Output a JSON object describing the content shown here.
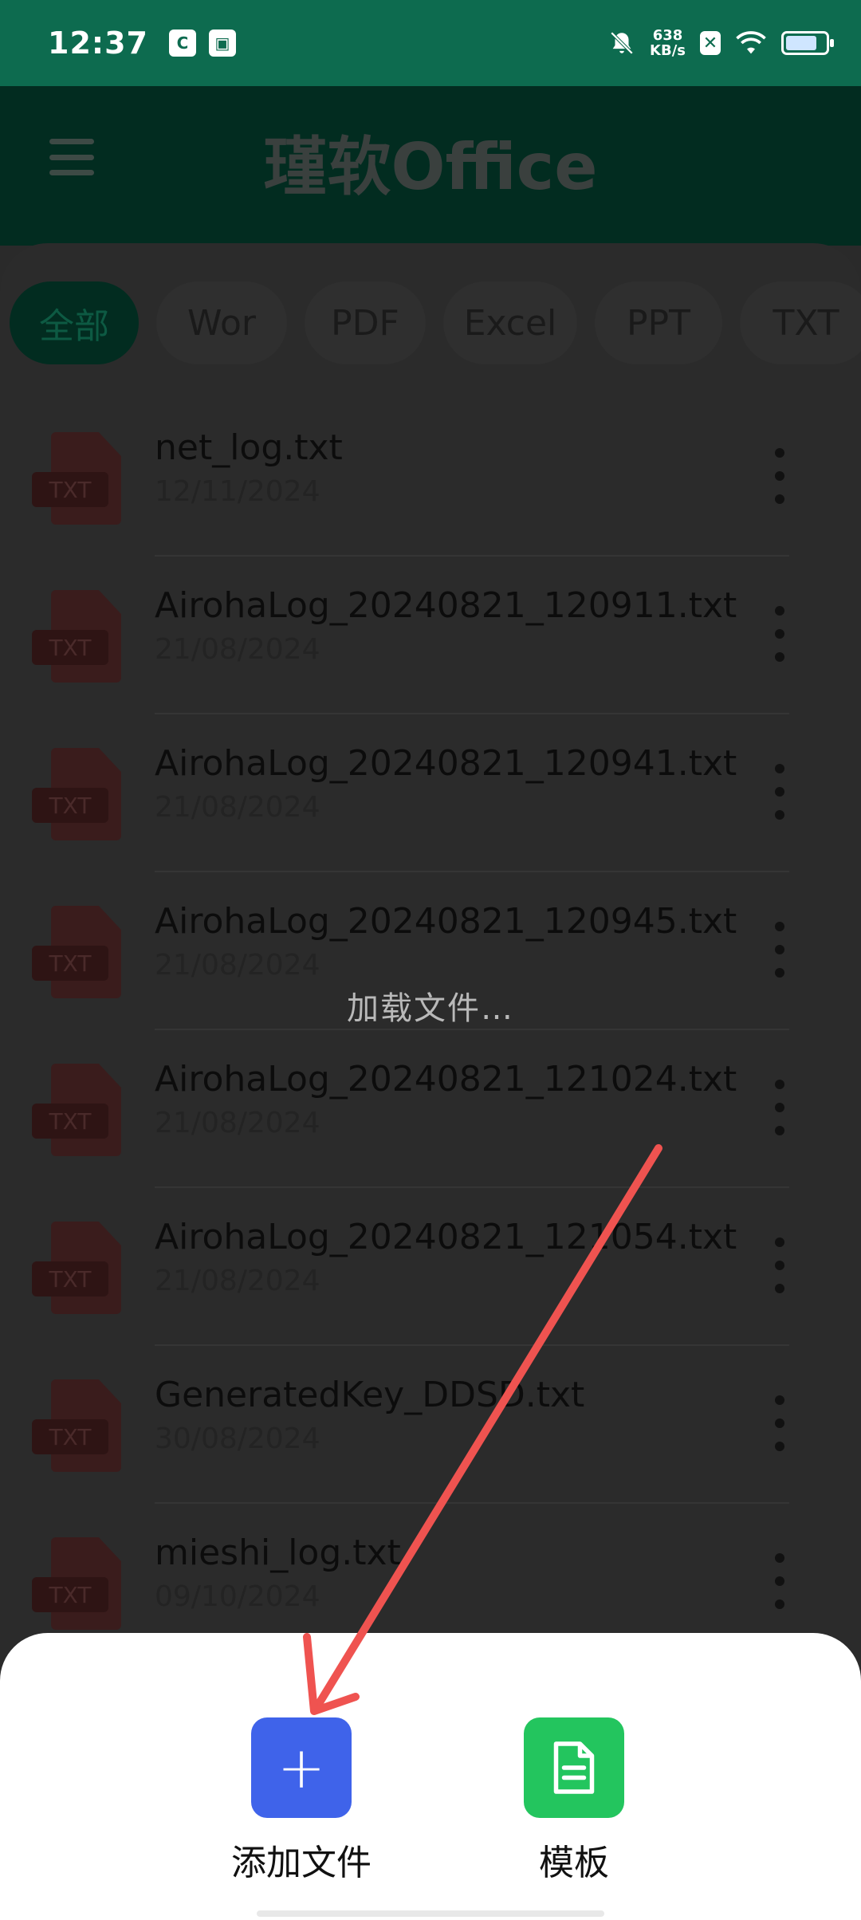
{
  "status_bar": {
    "time": "12:37",
    "net_speed_value": "638",
    "net_speed_unit": "KB/s",
    "icons": [
      "cc-icon",
      "notification-app-icon",
      "bell-muted-icon",
      "sim-x-icon",
      "wifi-icon",
      "battery-icon"
    ]
  },
  "header": {
    "title": "瑾软Office"
  },
  "filters": {
    "tabs": [
      {
        "label": "全部",
        "active": true
      },
      {
        "label": "Wor",
        "active": false
      },
      {
        "label": "PDF",
        "active": false
      },
      {
        "label": "Excel",
        "active": false
      },
      {
        "label": "PPT",
        "active": false
      },
      {
        "label": "TXT",
        "active": false
      }
    ]
  },
  "files": [
    {
      "name": "net_log.txt",
      "date": "12/11/2024",
      "type": "TXT"
    },
    {
      "name": "AirohaLog_20240821_120911.txt",
      "date": "21/08/2024",
      "type": "TXT"
    },
    {
      "name": "AirohaLog_20240821_120941.txt",
      "date": "21/08/2024",
      "type": "TXT"
    },
    {
      "name": "AirohaLog_20240821_120945.txt",
      "date": "21/08/2024",
      "type": "TXT"
    },
    {
      "name": "AirohaLog_20240821_121024.txt",
      "date": "21/08/2024",
      "type": "TXT"
    },
    {
      "name": "AirohaLog_20240821_121054.txt",
      "date": "21/08/2024",
      "type": "TXT"
    },
    {
      "name": "GeneratedKey_DDSD.txt",
      "date": "30/08/2024",
      "type": "TXT"
    },
    {
      "name": "mieshi_log.txt",
      "date": "09/10/2024",
      "type": "TXT"
    }
  ],
  "loading": {
    "text": "加载文件…"
  },
  "bottom_sheet": {
    "add_icon_glyph": "+",
    "add_label": "添加文件",
    "template_label": "模板"
  },
  "colors": {
    "status_bar": "#0d6b4f",
    "add_button": "#3f63ea",
    "template_button": "#23c55e",
    "annotation_arrow": "#ef5350"
  }
}
